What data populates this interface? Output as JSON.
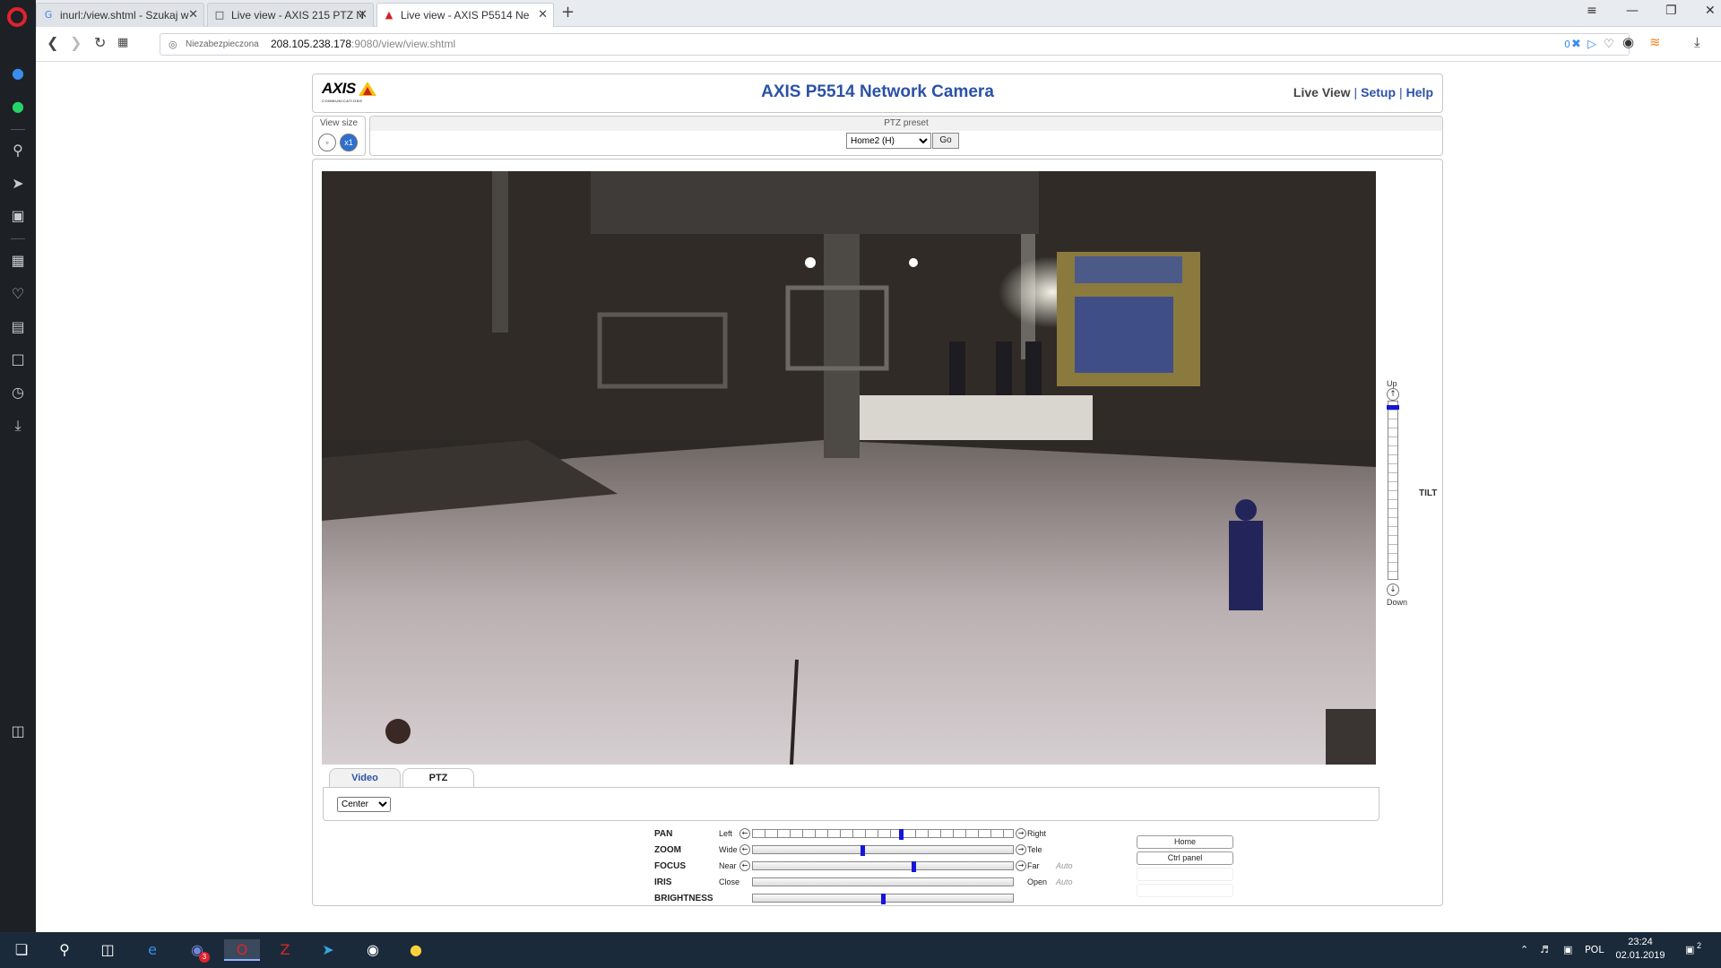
{
  "browser": {
    "tabs": [
      {
        "title": "inurl:/view.shtml - Szukaj w",
        "favicon": "google-icon"
      },
      {
        "title": "Live view - AXIS 215 PTZ N",
        "favicon": "page-icon"
      },
      {
        "title": "Live view - AXIS P5514 Ne",
        "favicon": "axis-icon"
      }
    ],
    "url": {
      "security": "Niezabezpieczona",
      "host": "208.105.238.178",
      "path": ":9080/view/view.shtml"
    },
    "badge_count": "0"
  },
  "camera_page": {
    "logo_text": "AXIS",
    "logo_sub": "COMMUNICATIONS",
    "title": "AXIS P5514 Network Camera",
    "nav": {
      "live_view": "Live View",
      "setup": "Setup",
      "help": "Help"
    },
    "view_size_label": "View size",
    "ptz_preset_label": "PTZ preset",
    "preset_selected": "Home2 (H)",
    "go_label": "Go",
    "tilt": {
      "up": "Up",
      "down": "Down",
      "label": "TILT",
      "level": 0.02
    },
    "tabs": [
      {
        "label": "Video"
      },
      {
        "label": "PTZ"
      }
    ],
    "mode_selected": "Center",
    "controls": [
      {
        "name": "PAN",
        "left": "Left",
        "right": "Right",
        "auto": "",
        "level": 0.57,
        "has_arrows": true
      },
      {
        "name": "ZOOM",
        "left": "Wide",
        "right": "Tele",
        "auto": "",
        "level": 0.42,
        "has_arrows": true
      },
      {
        "name": "FOCUS",
        "left": "Near",
        "right": "Far",
        "auto": "Auto",
        "level": 0.62,
        "has_arrows": true
      },
      {
        "name": "IRIS",
        "left": "Close",
        "right": "Open",
        "auto": "Auto",
        "level": null,
        "has_arrows": false
      },
      {
        "name": "BRIGHTNESS",
        "left": "",
        "right": "",
        "auto": "",
        "level": 0.5,
        "has_arrows": false
      }
    ],
    "home_button": "Home",
    "ctrl_panel_button": "Ctrl panel"
  },
  "taskbar": {
    "language": "POL",
    "time": "23:24",
    "date": "02.01.2019",
    "notification_count": "2",
    "discord_badge": "3"
  },
  "colors": {
    "axis_blue": "#2b52a6",
    "slider_knob": "#1616d8",
    "opera_red": "#e0222d"
  }
}
